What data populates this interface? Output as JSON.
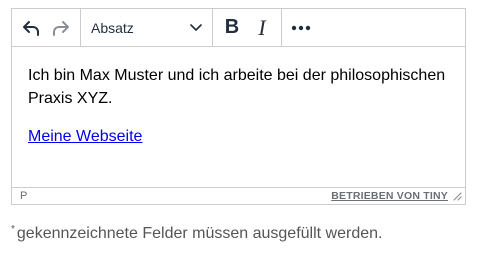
{
  "toolbar": {
    "undo_icon": "undo-icon",
    "redo_icon": "redo-icon",
    "format_select_value": "Absatz",
    "bold_label": "B",
    "italic_label": "I",
    "more_icon": "more-horizontal-icon"
  },
  "content": {
    "paragraph": "Ich bin Max Muster und ich arbeite bei der philosophischen Praxis XYZ.",
    "link_text": "Meine Webseite"
  },
  "statusbar": {
    "path": "P",
    "brand": "BETRIEBEN VON TINY"
  },
  "footnote": {
    "marker": "*",
    "text": "gekennzeichnete Felder müssen ausgefüllt werden."
  },
  "colors": {
    "border": "#cccccc",
    "icon": "#222f3e",
    "disabled_icon": "#8a8f96",
    "link": "#0000ee",
    "muted_text": "#555555"
  }
}
